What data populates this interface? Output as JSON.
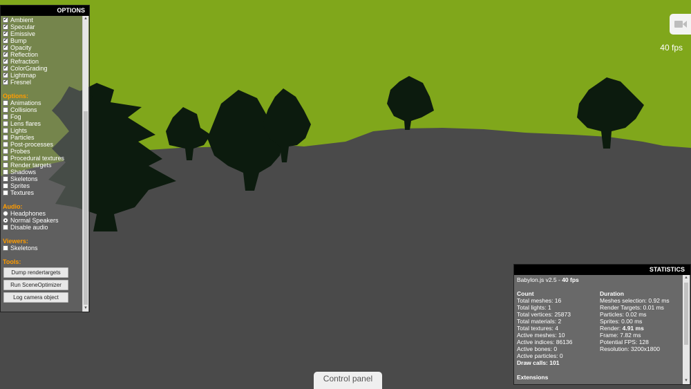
{
  "colors": {
    "sky": "#80a71b",
    "ground": "#4a4a4a",
    "trees": "#0c1b0e",
    "accent": "#ff9c00",
    "panel_header": "#000000"
  },
  "options_panel": {
    "title": "OPTIONS",
    "channels": [
      {
        "label": "Ambient",
        "checked": true
      },
      {
        "label": "Specular",
        "checked": true
      },
      {
        "label": "Emissive",
        "checked": true
      },
      {
        "label": "Bump",
        "checked": true
      },
      {
        "label": "Opacity",
        "checked": true
      },
      {
        "label": "Reflection",
        "checked": true
      },
      {
        "label": "Refraction",
        "checked": true
      },
      {
        "label": "ColorGrading",
        "checked": true
      },
      {
        "label": "Lightmap",
        "checked": true
      },
      {
        "label": "Fresnel",
        "checked": true
      }
    ],
    "options_title": "Options:",
    "options": [
      {
        "label": "Animations",
        "checked": false
      },
      {
        "label": "Collisions",
        "checked": false
      },
      {
        "label": "Fog",
        "checked": false
      },
      {
        "label": "Lens flares",
        "checked": false
      },
      {
        "label": "Lights",
        "checked": false
      },
      {
        "label": "Particles",
        "checked": false
      },
      {
        "label": "Post-processes",
        "checked": false
      },
      {
        "label": "Probes",
        "checked": false
      },
      {
        "label": "Procedural textures",
        "checked": false
      },
      {
        "label": "Render targets",
        "checked": false
      },
      {
        "label": "Shadows",
        "checked": false
      },
      {
        "label": "Skeletons",
        "checked": false
      },
      {
        "label": "Sprites",
        "checked": false
      },
      {
        "label": "Textures",
        "checked": false
      }
    ],
    "audio_title": "Audio:",
    "audio": [
      {
        "label": "Headphones",
        "type": "radio",
        "checked": false
      },
      {
        "label": "Normal Speakers",
        "type": "radio",
        "checked": true
      },
      {
        "label": "Disable audio",
        "type": "checkbox",
        "checked": false
      }
    ],
    "viewers_title": "Viewers:",
    "viewers": [
      {
        "label": "Skeletons",
        "checked": false
      }
    ],
    "tools_title": "Tools:",
    "tools": [
      "Dump rendertargets",
      "Run SceneOptimizer",
      "Log camera object"
    ]
  },
  "fps_label": "40 fps",
  "camera_icon": "video-camera-icon",
  "statistics": {
    "title": "STATISTICS",
    "version": "Babylon.js v2.5 - ",
    "version_fps": "40 fps",
    "count_title": "Count",
    "count": [
      {
        "text": "Total meshes: 16"
      },
      {
        "text": "Total lights: 1"
      },
      {
        "text": "Total vertices: 25873"
      },
      {
        "text": "Total materials: 2"
      },
      {
        "text": "Total textures: 4"
      },
      {
        "text": "Active meshes: 10"
      },
      {
        "text": "Active indices: 86136"
      },
      {
        "text": "Active bones: 0"
      },
      {
        "text": "Active particles: 0"
      }
    ],
    "draw_calls": "Draw calls: 101",
    "duration_title": "Duration",
    "duration": [
      {
        "text": "Meshes selection: 0.92 ms"
      },
      {
        "text": "Render Targets: 0.01 ms"
      },
      {
        "text": "Particles: 0.02 ms"
      },
      {
        "text": "Sprites: 0.00 ms"
      }
    ],
    "render_label": "Render: ",
    "render_value": "4.91 ms",
    "duration2": [
      {
        "text": "Frame: 7.82 ms"
      },
      {
        "text": "Potential FPS: 128"
      },
      {
        "text": "Resolution: 3200x1800"
      }
    ],
    "extensions_title": "Extensions"
  },
  "control_panel_label": "Control panel"
}
